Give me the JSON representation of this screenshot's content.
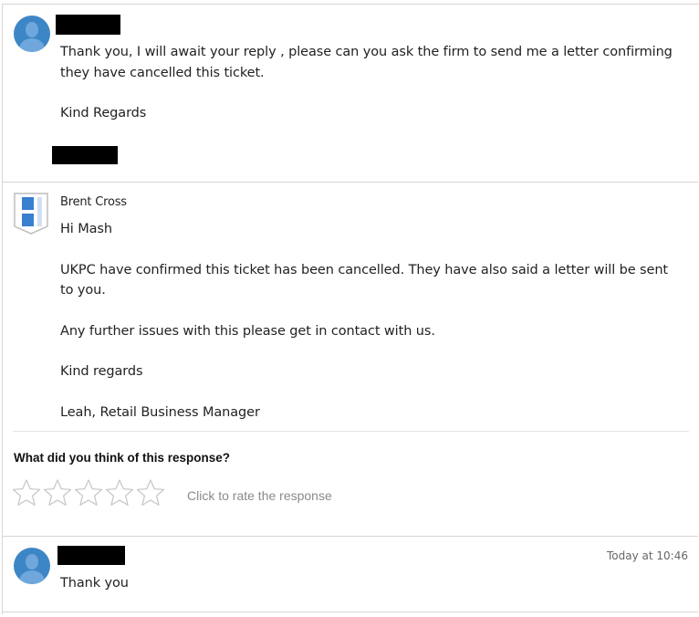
{
  "messages": [
    {
      "sender": "",
      "paragraphs": [
        "Thank you, I will await your reply , please can you ask the firm to send me a letter confirming they have cancelled this ticket.",
        "Kind Regards"
      ]
    },
    {
      "sender": "Brent Cross",
      "paragraphs": [
        "Hi Mash",
        "UKPC have confirmed this ticket has been cancelled. They have also said a letter will be sent to you.",
        "Any further issues with this please get in contact with us.",
        "Kind regards",
        "Leah, Retail Business Manager"
      ]
    },
    {
      "sender": "",
      "timestamp": "Today at 10:46",
      "paragraphs": [
        "Thank you"
      ]
    }
  ],
  "rating": {
    "question": "What did you think of this response?",
    "prompt": "Click to rate the response",
    "max_stars": 5,
    "current_value": 0
  },
  "colors": {
    "avatar": "#3d86c6",
    "redaction": "#000000",
    "divider": "#d4d4d4",
    "star_outline": "#c9c9c9"
  },
  "icons": {
    "user_avatar": "user-avatar-icon",
    "brand_logo": "brent-cross-shield-icon",
    "star": "star-outline-icon"
  }
}
